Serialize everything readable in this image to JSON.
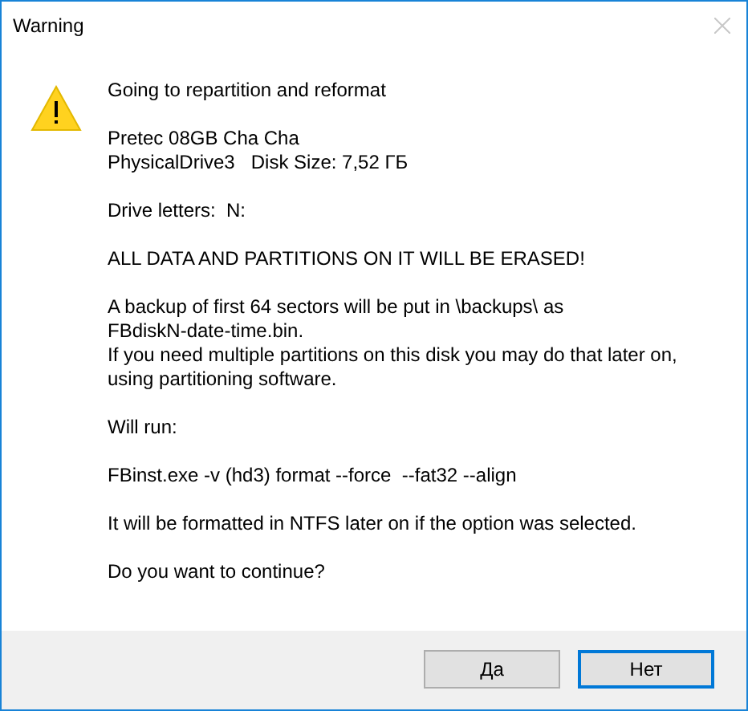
{
  "window": {
    "title": "Warning"
  },
  "message": {
    "paragraphs": [
      [
        "Going to repartition and reformat"
      ],
      [
        "Pretec 08GB Cha Cha",
        "PhysicalDrive3   Disk Size: 7,52 ГБ"
      ],
      [
        "Drive letters:  N:"
      ],
      [
        "ALL DATA AND PARTITIONS ON IT WILL BE ERASED!"
      ],
      [
        "A backup of first 64 sectors will be put in \\backups\\ as",
        "FBdiskN-date-time.bin.",
        "If you need multiple partitions on this disk you may do that later on,",
        "using partitioning software."
      ],
      [
        "Will run:"
      ],
      [
        "FBinst.exe -v (hd3) format --force  --fat32 --align"
      ],
      [
        "It will be formatted in NTFS later on if the option was selected."
      ],
      [
        "Do you want to continue?"
      ]
    ]
  },
  "buttons": [
    {
      "label": "Да",
      "focused": false
    },
    {
      "label": "Нет",
      "focused": true
    }
  ]
}
